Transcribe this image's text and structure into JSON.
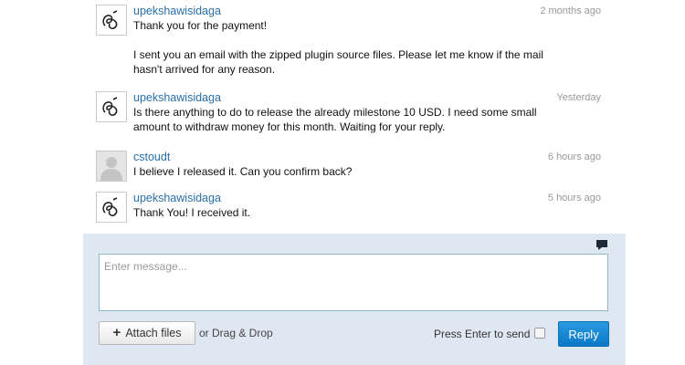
{
  "messages": [
    {
      "author": "upekshawisidaga",
      "time": "2 months ago",
      "lines": [
        "Thank you for the payment!",
        "I sent you an email with the zipped plugin source files. Please let me know if the mail hasn't arrived for any reason."
      ]
    },
    {
      "author": "upekshawisidaga",
      "time": "Yesterday",
      "lines": [
        "Is there anything to do to release the already milestone 10 USD. I need some small amount to withdraw money for this month. Waiting for your reply."
      ]
    },
    {
      "author": "cstoudt",
      "time": "6 hours ago",
      "lines": [
        "I believe I released it. Can you confirm back?"
      ]
    },
    {
      "author": "upekshawisidaga",
      "time": "5 hours ago",
      "lines": [
        "Thank You! I received it."
      ]
    }
  ],
  "composer": {
    "placeholder": "Enter message...",
    "attach_label": "Attach files",
    "drag_text": "or Drag & Drop",
    "enter_label": "Press Enter to send",
    "enter_checked": false,
    "reply_label": "Reply"
  },
  "colors": {
    "link": "#2a6fa8",
    "composer_bg": "#dfe8f2",
    "reply_button": "#0a78c8"
  }
}
